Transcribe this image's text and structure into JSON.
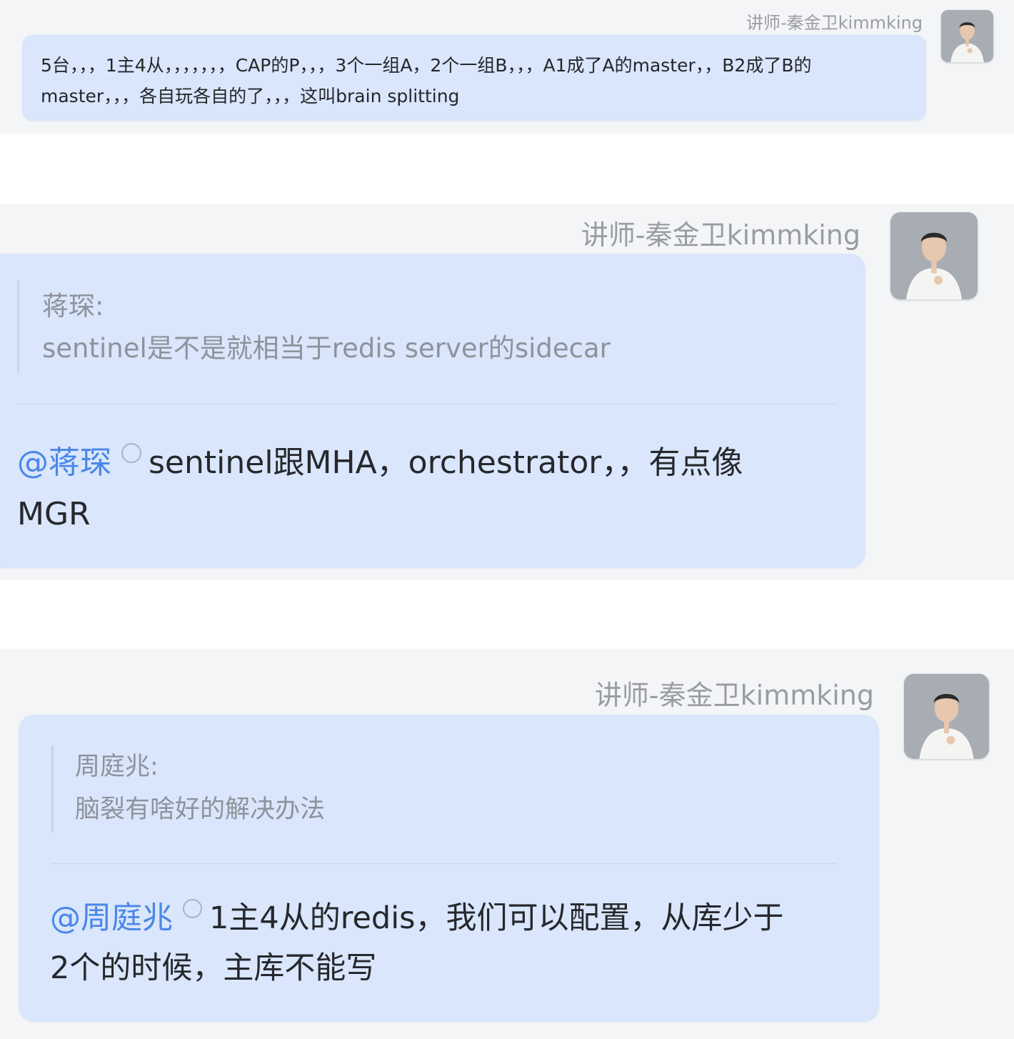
{
  "messages": [
    {
      "sender": "讲师-秦金卫kimmking",
      "text": "5台，，，1主4从，，，，，，，CAP的P，，，3个一组A，2个一组B，，，A1成了A的master，，B2成了B的master，，，各自玩各自的了，，，这叫brain splitting"
    },
    {
      "sender": "讲师-秦金卫kimmking",
      "quote_author": "蒋琛:",
      "quote_text": "sentinel是不是就相当于redis server的sidecar",
      "mention": "@蒋琛",
      "reply_line1": "sentinel跟MHA，orchestrator，，有点像",
      "reply_line2": "MGR"
    },
    {
      "sender": "讲师-秦金卫kimmking",
      "quote_author": "周庭兆:",
      "quote_text": "脑裂有啥好的解决办法",
      "mention": "@周庭兆",
      "reply_line1": "1主4从的redis，我们可以配置，从库少于",
      "reply_line2": "2个的时候，主库不能写"
    }
  ]
}
